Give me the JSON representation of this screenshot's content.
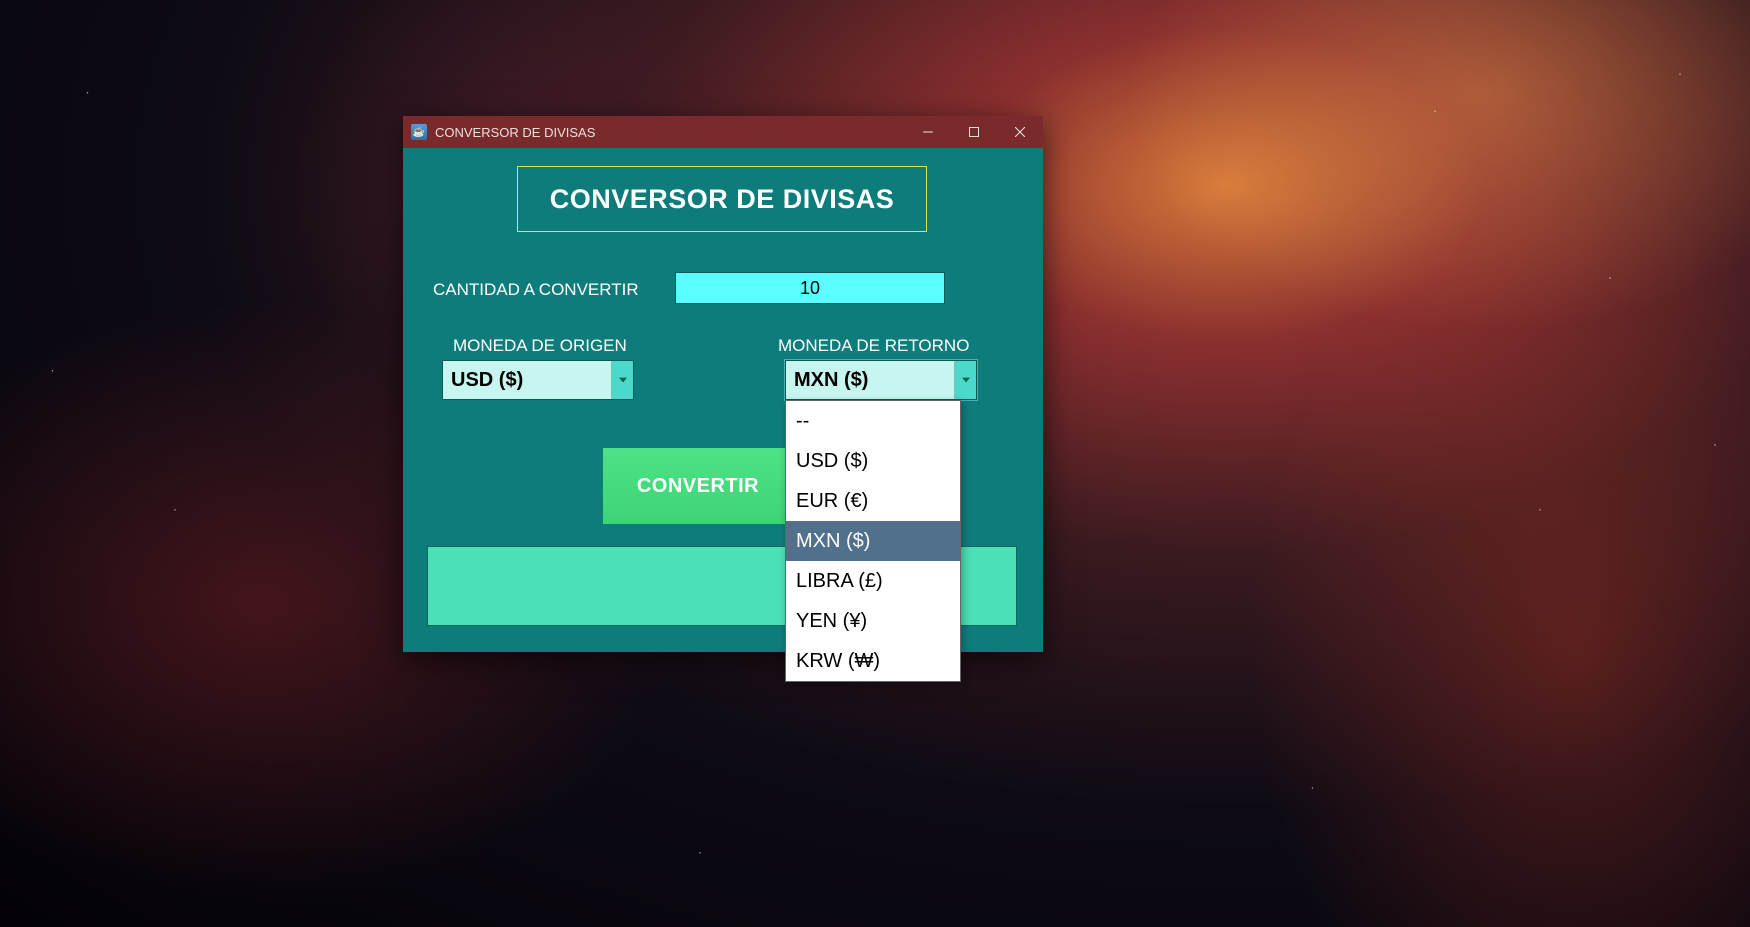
{
  "window": {
    "title": "CONVERSOR DE DIVISAS"
  },
  "heading": "CONVERSOR DE DIVISAS",
  "labels": {
    "cantidad": "CANTIDAD A CONVERTIR",
    "origen": "MONEDA DE ORIGEN",
    "retorno": "MONEDA DE RETORNO"
  },
  "amount": "10",
  "origen_selected": "USD ($)",
  "retorno_selected": "MXN ($)",
  "convert_label": "CONVERTIR",
  "result": "",
  "dropdown_options": [
    "--",
    "USD ($)",
    "EUR (€)",
    "MXN ($)",
    "LIBRA (£)",
    "YEN (¥)",
    "KRW (₩)"
  ],
  "dropdown_highlight_index": 3
}
